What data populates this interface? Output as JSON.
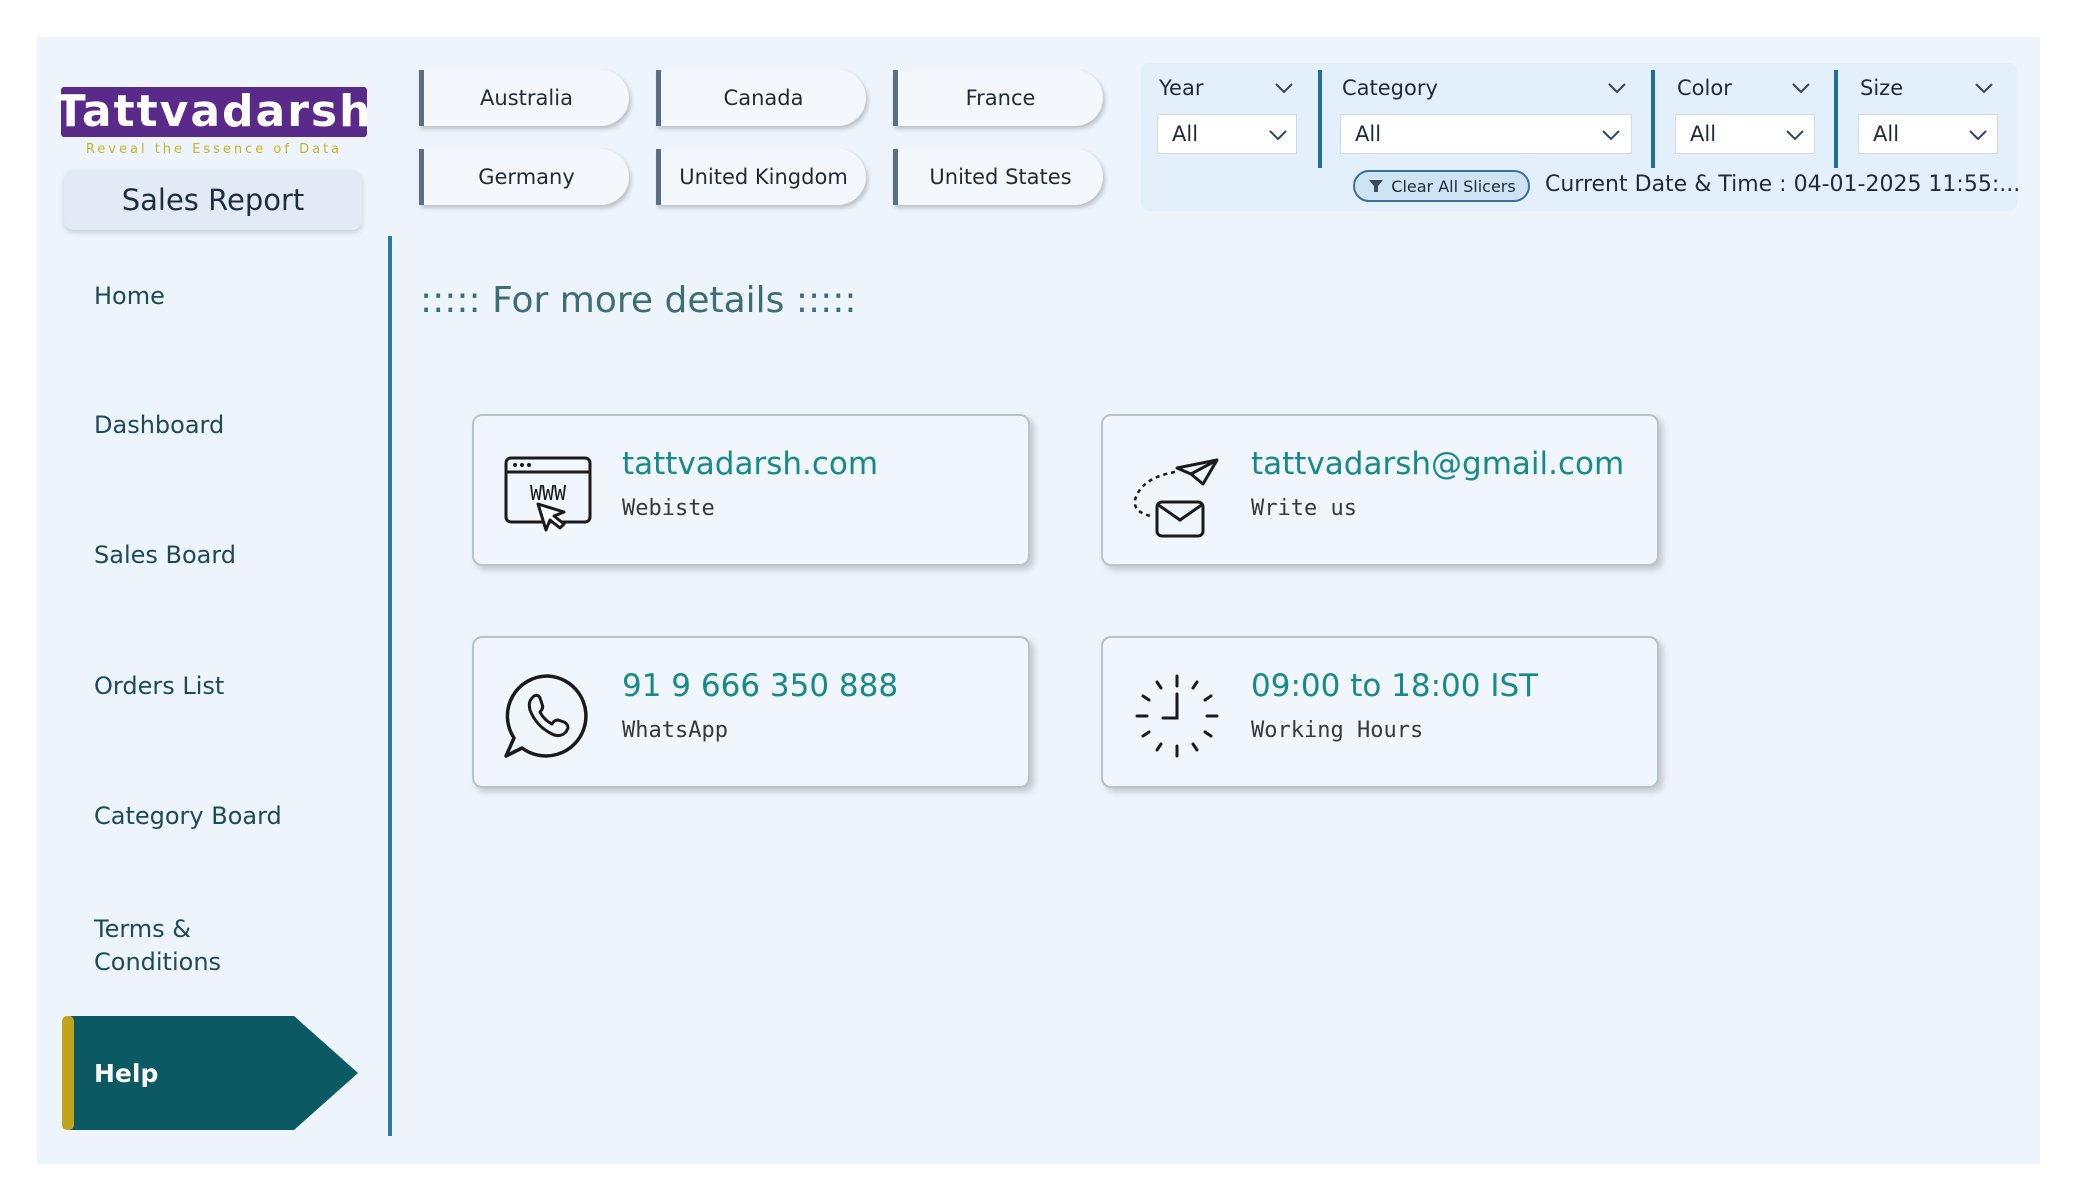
{
  "brand": {
    "logo_text": "Tattvadarsh",
    "tagline": "Reveal the Essence of Data",
    "report_title": "Sales Report",
    "logo_color": "#5a2a8a",
    "tagline_color": "#c9b324"
  },
  "countries": [
    "Australia",
    "Canada",
    "France",
    "Germany",
    "United Kingdom",
    "United States"
  ],
  "slicers": {
    "year": {
      "title": "Year",
      "value": "All"
    },
    "category": {
      "title": "Category",
      "value": "All"
    },
    "color": {
      "title": "Color",
      "value": "All"
    },
    "size": {
      "title": "Size",
      "value": "All"
    }
  },
  "clear_slicers_label": "Clear All Slicers",
  "datetime_text": "Current Date & Time : 04-01-2025 11:55:...",
  "nav": {
    "home": "Home",
    "dashboard": "Dashboard",
    "sales_board": "Sales Board",
    "orders_list": "Orders List",
    "category_board": "Category Board",
    "terms_line1": "Terms &",
    "terms_line2": "Conditions",
    "help": "Help",
    "active": "Help",
    "active_color": "#0b5a63",
    "active_accent": "#c3a31c"
  },
  "section_heading": "::::: For more details :::::",
  "contacts": {
    "website": {
      "main": "tattvadarsh.com",
      "sub": "Webiste",
      "icon": "www-browser-icon"
    },
    "email": {
      "main": "tattvadarsh@gmail.com",
      "sub": "Write us",
      "icon": "mail-send-icon"
    },
    "phone": {
      "main": "91 9 666 350 888",
      "sub": "WhatsApp",
      "icon": "whatsapp-icon"
    },
    "hours": {
      "main": "09:00 to 18:00 IST",
      "sub": "Working Hours",
      "icon": "clock-icon"
    }
  }
}
